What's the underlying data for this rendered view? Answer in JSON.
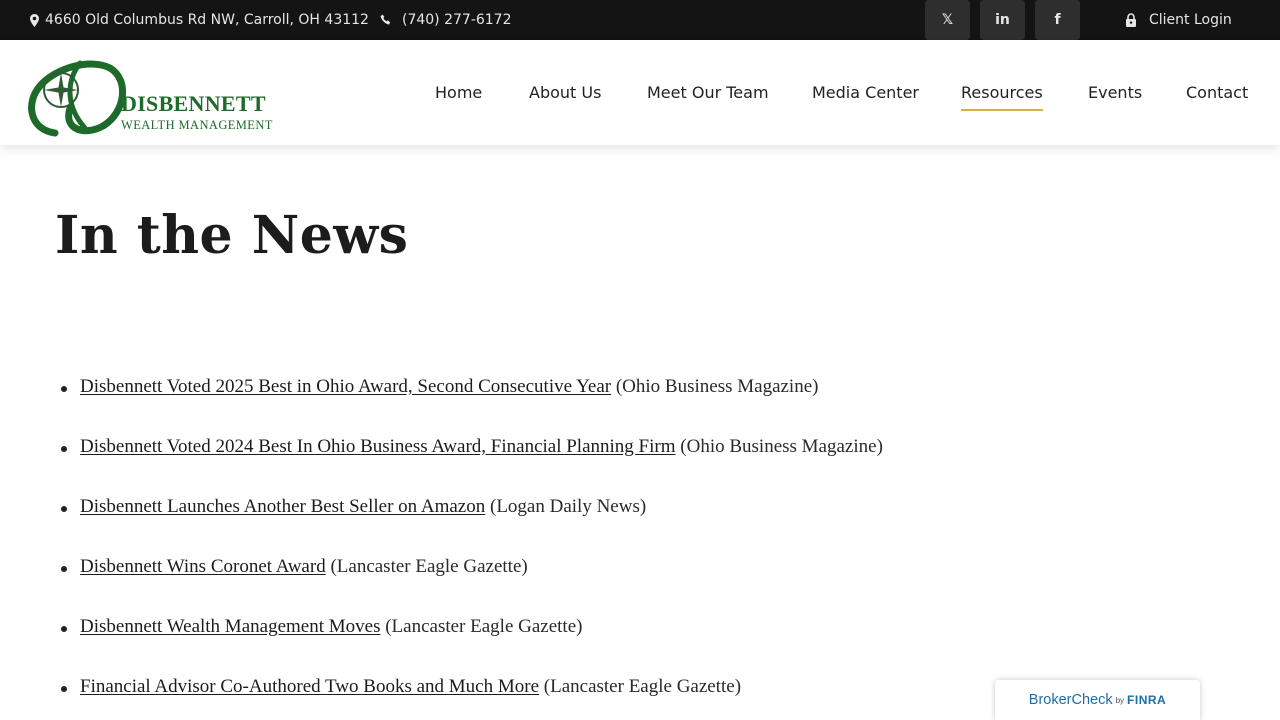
{
  "topbar": {
    "address": "4660 Old Columbus Rd NW, Carroll, OH 43112",
    "phone": "(740) 277-6172",
    "social": [
      {
        "icon": "x-twitter-icon",
        "glyph": "𝕏"
      },
      {
        "icon": "linkedin-icon",
        "glyph": "in"
      },
      {
        "icon": "facebook-icon",
        "glyph": "f"
      }
    ],
    "login_label": "Client Login"
  },
  "logo": {
    "name": "DISBENNETT",
    "subtitle": "WEALTH MANAGEMENT",
    "brand_color": "#1e6a2a"
  },
  "nav": {
    "items": [
      "Home",
      "About Us",
      "Meet Our Team",
      "Media Center",
      "Resources",
      "Events",
      "Contact"
    ],
    "active": "Resources",
    "active_underline_color": "#d6b24a"
  },
  "page": {
    "title": "In the News"
  },
  "news": [
    {
      "link": "Disbennett Voted 2025 Best in Ohio Award, Second Consecutive Year",
      "source": "(Ohio Business Magazine)"
    },
    {
      "link": "Disbennett Voted 2024 Best In Ohio Business Award, Financial Planning Firm",
      "source": "(Ohio Business Magazine)"
    },
    {
      "link": "Disbennett Launches Another Best Seller on Amazon",
      "source": "(Logan Daily News)"
    },
    {
      "link": "Disbennett Wins Coronet Award",
      "source": "(Lancaster Eagle Gazette)"
    },
    {
      "link": "Disbennett Wealth Management Moves",
      "source": "(Lancaster Eagle Gazette)"
    },
    {
      "link": "Financial Advisor Co-Authored Two Books and Much More",
      "source": "(Lancaster Eagle Gazette)"
    }
  ],
  "brokercheck": {
    "label": "BrokerCheck",
    "by": "by",
    "finra": "FINRA"
  }
}
